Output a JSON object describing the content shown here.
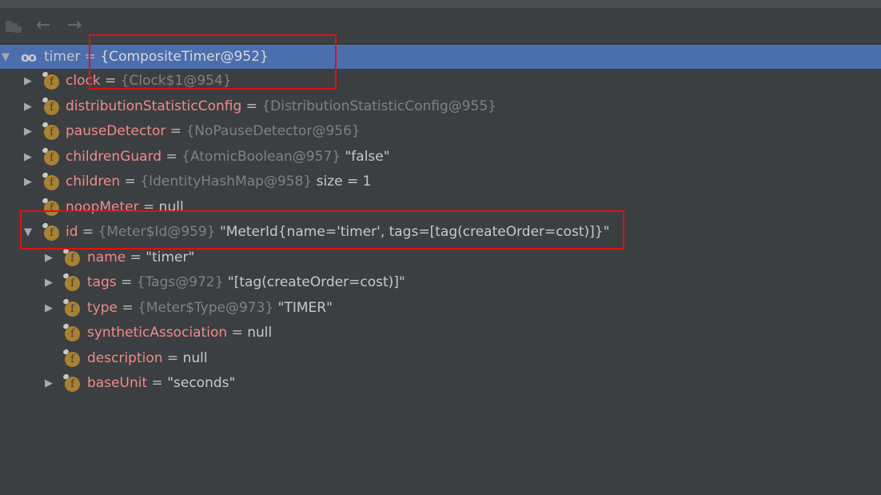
{
  "toolbar": {
    "icons": [
      "restore-layout-icon",
      "back-arrow-icon",
      "forward-arrow-icon"
    ],
    "back": "←",
    "forward": "→"
  },
  "tree": [
    {
      "level": 0,
      "expanded": true,
      "icon": "watch-icon",
      "name": "timer",
      "type": "{CompositeTimer@952}",
      "value": "",
      "selected": true
    },
    {
      "level": 1,
      "expanded": false,
      "icon": "field-icon",
      "name": "clock",
      "type": "{Clock$1@954}",
      "value": ""
    },
    {
      "level": 1,
      "expanded": false,
      "icon": "field-icon",
      "name": "distributionStatisticConfig",
      "type": "{DistributionStatisticConfig@955}",
      "value": ""
    },
    {
      "level": 1,
      "expanded": false,
      "icon": "field-icon",
      "name": "pauseDetector",
      "type": "{NoPauseDetector@956}",
      "value": ""
    },
    {
      "level": 1,
      "expanded": false,
      "icon": "field-icon",
      "name": "childrenGuard",
      "type": "{AtomicBoolean@957}",
      "value": "\"false\""
    },
    {
      "level": 1,
      "expanded": false,
      "icon": "field-icon",
      "name": "children",
      "type": "{IdentityHashMap@958}",
      "value": " size = 1"
    },
    {
      "level": 1,
      "leaf": true,
      "icon": "field-icon",
      "name": "noopMeter",
      "type": "",
      "value": "null"
    },
    {
      "level": 1,
      "expanded": true,
      "icon": "field-icon",
      "name": "id",
      "type": "{Meter$Id@959}",
      "value": "\"MeterId{name='timer', tags=[tag(createOrder=cost)]}\""
    },
    {
      "level": 2,
      "expanded": false,
      "icon": "field-icon",
      "name": "name",
      "type": "",
      "value": "\"timer\""
    },
    {
      "level": 2,
      "expanded": false,
      "icon": "field-icon",
      "name": "tags",
      "type": "{Tags@972}",
      "value": "\"[tag(createOrder=cost)]\""
    },
    {
      "level": 2,
      "expanded": false,
      "icon": "field-icon",
      "name": "type",
      "type": "{Meter$Type@973}",
      "value": "\"TIMER\""
    },
    {
      "level": 2,
      "leaf": true,
      "icon": "field-icon",
      "name": "syntheticAssociation",
      "type": "",
      "value": "null"
    },
    {
      "level": 2,
      "leaf": true,
      "icon": "field-icon",
      "name": "description",
      "type": "",
      "value": "null"
    },
    {
      "level": 2,
      "expanded": false,
      "icon": "field-icon",
      "name": "baseUnit",
      "type": "",
      "value": "\"seconds\""
    }
  ],
  "colors": {
    "background": "#3c3f41",
    "selection": "#4b6eaf",
    "field_name": "#f08a8a",
    "annotation": "#e01010"
  }
}
